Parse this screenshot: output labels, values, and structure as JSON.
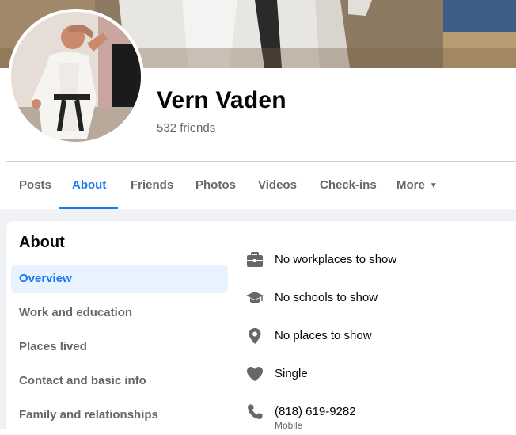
{
  "profile": {
    "name": "Vern Vaden",
    "friends": "532 friends"
  },
  "tabs": [
    {
      "label": "Posts"
    },
    {
      "label": "About"
    },
    {
      "label": "Friends"
    },
    {
      "label": "Photos"
    },
    {
      "label": "Videos"
    },
    {
      "label": "Check-ins"
    },
    {
      "label": "More"
    }
  ],
  "active_tab": "About",
  "about": {
    "title": "About",
    "nav": [
      {
        "label": "Overview"
      },
      {
        "label": "Work and education"
      },
      {
        "label": "Places lived"
      },
      {
        "label": "Contact and basic info"
      },
      {
        "label": "Family and relationships"
      }
    ],
    "info": [
      {
        "icon": "briefcase-icon",
        "text": "No workplaces to show"
      },
      {
        "icon": "graduation-cap-icon",
        "text": "No schools to show"
      },
      {
        "icon": "location-pin-icon",
        "text": "No places to show"
      },
      {
        "icon": "heart-icon",
        "text": "Single"
      },
      {
        "icon": "phone-icon",
        "text": "(818) 619-9282",
        "sub": "Mobile"
      }
    ]
  },
  "colors": {
    "accent": "#1877f2",
    "secondary_text": "#65676b",
    "page_bg": "#f0f2f5",
    "icon_gray": "#65676b",
    "active_nav_bg": "#e7f3ff"
  }
}
